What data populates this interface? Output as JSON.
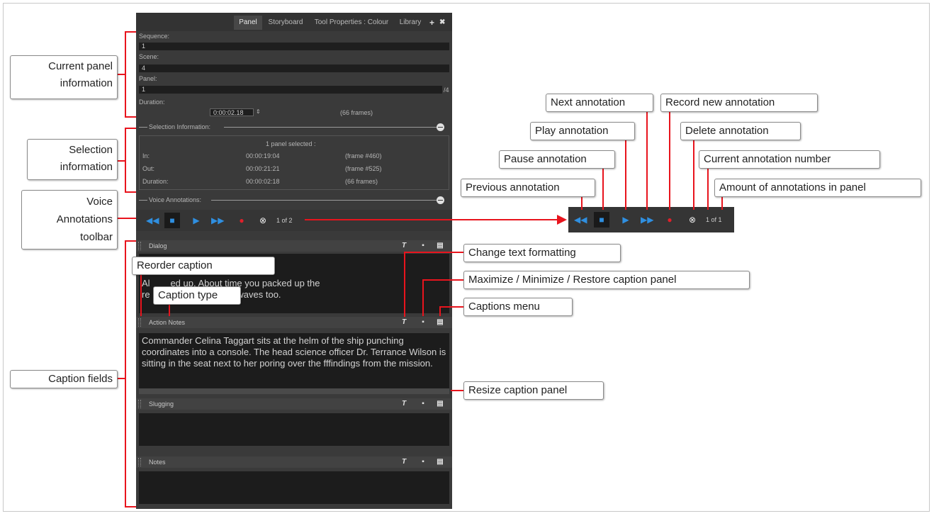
{
  "tabs": [
    "Panel",
    "Storyboard",
    "Tool Properties : Colour",
    "Library"
  ],
  "tab_tools": {
    "add": "+",
    "close": "✖"
  },
  "fields": {
    "sequence_label": "Sequence:",
    "sequence_value": "1",
    "scene_label": "Scene:",
    "scene_value": "4",
    "panel_label": "Panel:",
    "panel_value": "1",
    "panel_total": "/4",
    "duration_label": "Duration:",
    "duration_value": "0:00:02.18",
    "duration_frames": "(66 frames)"
  },
  "selection": {
    "header": "Selection Information:",
    "summary": "1 panel selected :",
    "rows": [
      {
        "label": "In:",
        "time": "00:00:19:04",
        "frame": "(frame #460)"
      },
      {
        "label": "Out:",
        "time": "00:00:21:21",
        "frame": "(frame #525)"
      },
      {
        "label": "Duration:",
        "time": "00:00:02:18",
        "frame": "(66 frames)"
      }
    ]
  },
  "voice": {
    "header": "Voice Annotations:",
    "counter": "1 of 2",
    "counter_small": "1 of 1"
  },
  "captions": [
    {
      "title": "Dialog",
      "text": "Al        ed up. About time you packed up the\nre                    ne theta waves too."
    },
    {
      "title": "Action Notes",
      "text": "Commander Celina Taggart sits at the helm of the ship punching coordinates into a console. The head science officer Dr. Terrance Wilson is sitting in the seat next to her poring over the fffindings from the mission."
    },
    {
      "title": "Slugging",
      "text": ""
    },
    {
      "title": "Notes",
      "text": ""
    }
  ],
  "callouts": {
    "current_panel": "Current panel\ninformation",
    "selection_info": "Selection\ninformation",
    "voice_toolbar": "Voice\nAnnotations\ntoolbar",
    "caption_fields": "Caption fields",
    "reorder_caption": "Reorder caption",
    "caption_type": "Caption type",
    "change_text": "Change text formatting",
    "maximize": "Maximize / Minimize / Restore caption panel",
    "captions_menu": "Captions menu",
    "resize": "Resize caption panel",
    "previous": "Previous annotation",
    "pause": "Pause annotation",
    "play": "Play annotation",
    "next": "Next annotation",
    "record": "Record new annotation",
    "delete": "Delete annotation",
    "current_number": "Current annotation number",
    "amount": "Amount of annotations in panel"
  },
  "colors": {
    "accent_red": "#e8141d",
    "play_blue": "#2f8fe0",
    "record_red": "#e0202a"
  }
}
